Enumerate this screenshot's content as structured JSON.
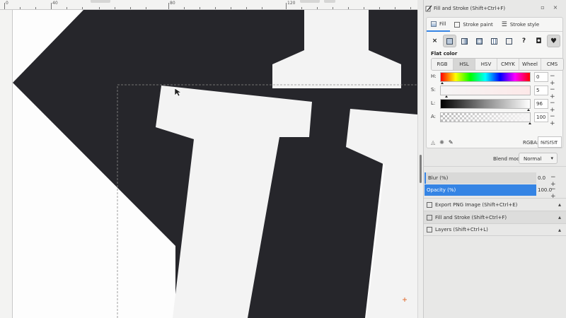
{
  "top_ruler": {
    "labels": [
      "0",
      "40",
      "80",
      "120"
    ]
  },
  "dock": {
    "title": "Fill and Stroke (Shift+Ctrl+F)",
    "tabs": [
      {
        "label": "Fill",
        "icon": "fill-icon"
      },
      {
        "label": "Stroke paint",
        "icon": "stroke-paint-icon"
      },
      {
        "label": "Stroke style",
        "icon": "stroke-style-icon"
      }
    ],
    "paint_types": [
      "×",
      "",
      "",
      "",
      "",
      "",
      "?",
      "",
      ""
    ],
    "flat_color_label": "Flat color",
    "color_modes": [
      "RGB",
      "HSL",
      "HSV",
      "CMYK",
      "Wheel",
      "CMS"
    ],
    "active_mode": "HSL",
    "sliders": [
      {
        "label": "H:",
        "value": "0"
      },
      {
        "label": "S:",
        "value": "5"
      },
      {
        "label": "L:",
        "value": "96"
      },
      {
        "label": "A:",
        "value": "100"
      }
    ],
    "rgba_label": "RGBA:",
    "rgba_value": "f6f5f5ff",
    "blend_label": "Blend mode:",
    "blend_value": "Normal",
    "blur_label": "Blur (%)",
    "blur_value": "0.0",
    "opacity_label": "Opacity (%)",
    "opacity_value": "100.0",
    "collapsed_panels": [
      "Export PNG Image (Shift+Ctrl+E)",
      "Fill and Stroke (Shift+Ctrl+F)",
      "Layers (Shift+Ctrl+L)"
    ]
  },
  "colors": {
    "shape_dark": "#26262b",
    "shape_light": "#f3f3f3",
    "accent": "#3584e4"
  }
}
